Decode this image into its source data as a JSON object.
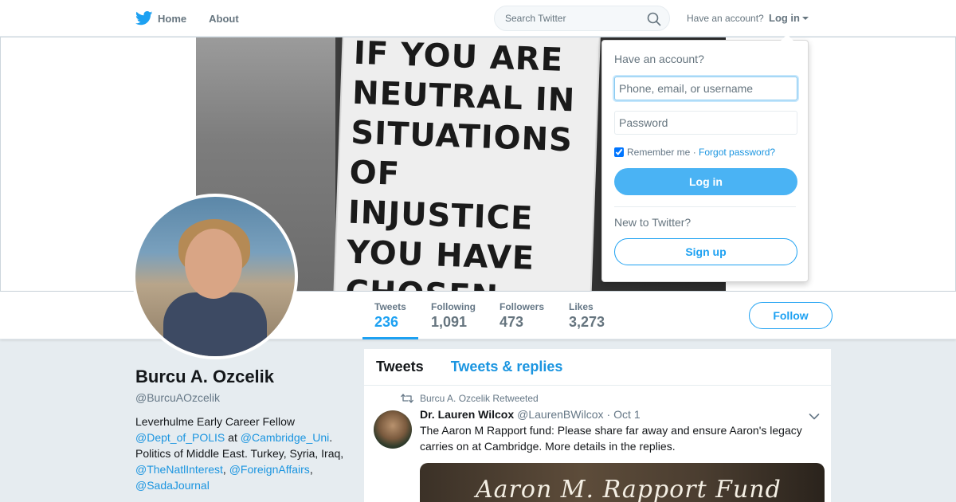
{
  "nav": {
    "home_label": "Home",
    "about_label": "About",
    "search_placeholder": "Search Twitter",
    "account_prompt": "Have an account?",
    "login_label": "Log in",
    "accent_color": "#1da1f2"
  },
  "banner": {
    "sign_text": "IF YOU ARE\nNEUTRAL IN\nSITUATIONS OF\nINJUSTICE\nYOU HAVE CHOSEN\nTHE SIDE OF THE\nOPPRESSOR"
  },
  "stats": [
    {
      "label": "Tweets",
      "value": "236",
      "active": true
    },
    {
      "label": "Following",
      "value": "1,091",
      "active": false
    },
    {
      "label": "Followers",
      "value": "473",
      "active": false
    },
    {
      "label": "Likes",
      "value": "3,273",
      "active": false
    }
  ],
  "follow_label": "Follow",
  "profile": {
    "name": "Burcu A. Ozcelik",
    "handle": "@BurcuAOzcelik",
    "bio": {
      "line1": "Leverhulme Early Career Fellow",
      "mention1": "@Dept_of_POLIS",
      "at": " at ",
      "mention2": "@Cambridge_Uni",
      "period": ".",
      "line2": "Politics of Middle East. Turkey, Syria, Iraq,",
      "mention3": "@TheNatlInterest",
      "mention4": "@ForeignAffairs",
      "mention5": "@SadaJournal",
      "comma": ","
    }
  },
  "timeline": {
    "tabs": [
      {
        "label": "Tweets",
        "active": true
      },
      {
        "label": "Tweets & replies",
        "active": false
      }
    ],
    "tweet": {
      "context": "Burcu A. Ozcelik Retweeted",
      "name": "Dr. Lauren Wilcox",
      "handle": "@LaurenBWilcox",
      "time": "Oct 1",
      "separator": "·",
      "text": "The Aaron M Rapport fund: Please share far away and ensure Aaron's legacy carries on at Cambridge. More details in the replies.",
      "card_title": "Aaron M. Rapport Fund"
    }
  },
  "login_dropdown": {
    "heading": "Have an account?",
    "username_placeholder": "Phone, email, or username",
    "password_placeholder": "Password",
    "remember_label": "Remember me",
    "separator": " · ",
    "forgot_label": "Forgot password?",
    "remember_checked": true,
    "login_button": "Log in",
    "new_prompt": "New to Twitter?",
    "signup_button": "Sign up"
  }
}
